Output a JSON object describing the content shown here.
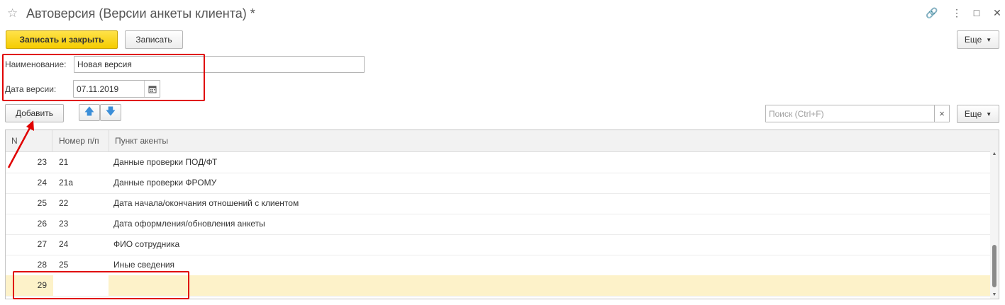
{
  "window": {
    "title": "Автоверсия (Версии анкеты клиента) *",
    "star_icon": "☆",
    "link_icon": "🔗",
    "more_icon": "⋮",
    "maximize_icon": "□",
    "close_icon": "✕"
  },
  "toolbar": {
    "save_close_label": "Записать и закрыть",
    "save_label": "Записать",
    "more_label": "Еще"
  },
  "form": {
    "name_label": "Наименование:",
    "name_value": "Новая версия",
    "date_label": "Дата версии:",
    "date_value": "07.11.2019"
  },
  "table_toolbar": {
    "add_label": "Добавить",
    "up_icon": "🡅",
    "down_icon": "🡇",
    "search_placeholder": "Поиск (Ctrl+F)",
    "search_clear": "×",
    "more_label": "Еще"
  },
  "table": {
    "columns": [
      "N",
      "Номер п/п",
      "Пункт акенты"
    ],
    "rows": [
      {
        "n": "23",
        "num": "21",
        "item": "Данные проверки ПОД/ФТ"
      },
      {
        "n": "24",
        "num": "21а",
        "item": "Данные проверки ФРОМУ"
      },
      {
        "n": "25",
        "num": "22",
        "item": "Дата начала/окончания отношений с клиентом"
      },
      {
        "n": "26",
        "num": "23",
        "item": "Дата оформления/обновления анкеты"
      },
      {
        "n": "27",
        "num": "24",
        "item": "ФИО сотрудника"
      },
      {
        "n": "28",
        "num": "25",
        "item": "Иные сведения"
      },
      {
        "n": "29",
        "num": "",
        "item": ""
      }
    ]
  },
  "colors": {
    "primary_button": "#f5cc00",
    "annotation_red": "#e00000",
    "selected_row": "#fdf2c9",
    "arrow_icon_blue": "#3b8ed8"
  }
}
